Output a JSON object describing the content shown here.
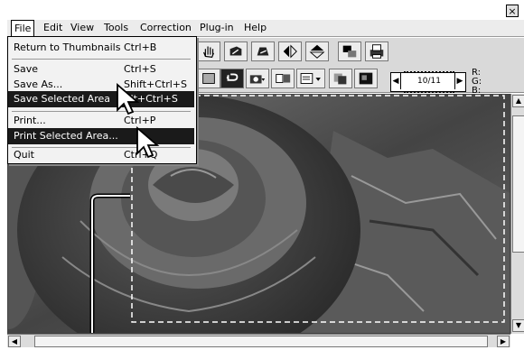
{
  "window": {
    "close_glyph": "×"
  },
  "menubar": {
    "items": [
      {
        "label": "File"
      },
      {
        "label": "Edit"
      },
      {
        "label": "View"
      },
      {
        "label": "Tools"
      },
      {
        "label": "Correction"
      },
      {
        "label": "Plug-in"
      },
      {
        "label": "Help"
      }
    ]
  },
  "file_menu": {
    "items": [
      {
        "label": "Return to Thumbnails",
        "shortcut": "Ctrl+B",
        "highlighted": false
      },
      {
        "label": "Save",
        "shortcut": "Ctrl+S",
        "highlighted": false
      },
      {
        "label": "Save As...",
        "shortcut": "Shift+Ctrl+S",
        "highlighted": false
      },
      {
        "label": "Save Selected Area",
        "shortcut": "Alt+Ctrl+S",
        "highlighted": true
      },
      {
        "label": "Print...",
        "shortcut": "Ctrl+P",
        "highlighted": false
      },
      {
        "label": "Print Selected Area...",
        "shortcut": "",
        "highlighted": true
      },
      {
        "label": "Quit",
        "shortcut": "Ctrl+Q",
        "highlighted": false
      }
    ]
  },
  "frame_counter": {
    "value": "10/11"
  },
  "rgb_readout": {
    "r": "R:",
    "g": "G:",
    "b": "B:"
  },
  "colors": {
    "highlight": "#1a1a1a",
    "menu_bg": "#f2f2f2",
    "toolbar_bg": "#d9d9d9"
  }
}
